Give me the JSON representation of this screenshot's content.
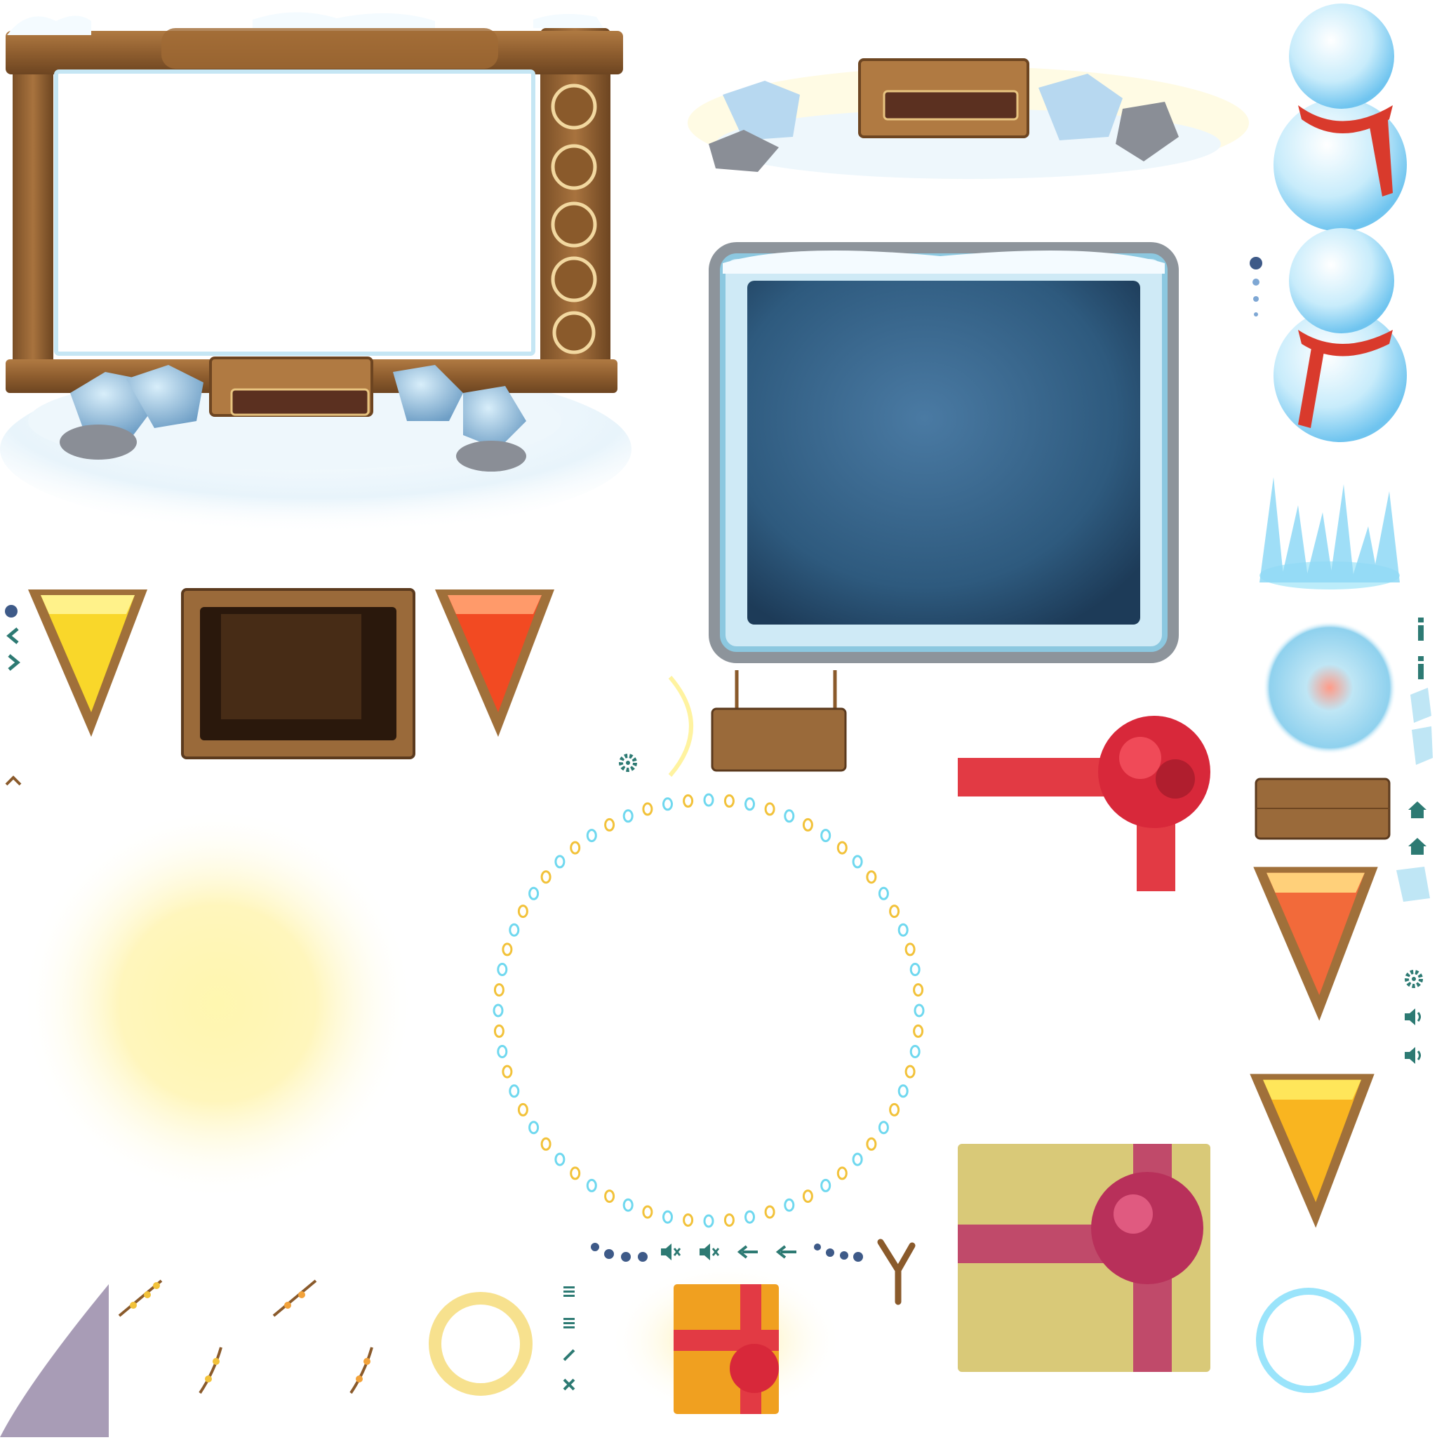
{
  "sheet": {
    "type": "game-ui-sprite-atlas",
    "theme": "winter"
  },
  "colors": {
    "wood": "#9a6a3a",
    "wood_dark": "#5b3a1e",
    "ice": "#bfe6f5",
    "ice_edge": "#8cc8e0",
    "board": "#2e5a7e",
    "ribbon": "#e23a44",
    "gold": "#f2c23a",
    "teal_icon": "#2d7a73",
    "snow": "#f6fbff",
    "gift_paper": "#d9c978"
  },
  "icons": [
    "gear-icon",
    "home-icon",
    "speaker-icon",
    "mute-icon",
    "back-arrow-icon",
    "menu-icon",
    "close-icon",
    "info-icon",
    "chevron-left-icon",
    "chevron-right-icon",
    "chevron-up-icon",
    "slingshot-icon"
  ],
  "pie_slices": [
    {
      "name": "yellow-slice",
      "fill": "#f9d72a"
    },
    {
      "name": "red-slice",
      "fill": "#f24a22"
    },
    {
      "name": "orange-red-slice",
      "fill": "#f26a3a"
    },
    {
      "name": "orange-yellow-slice",
      "fill": "#f9b520"
    }
  ]
}
